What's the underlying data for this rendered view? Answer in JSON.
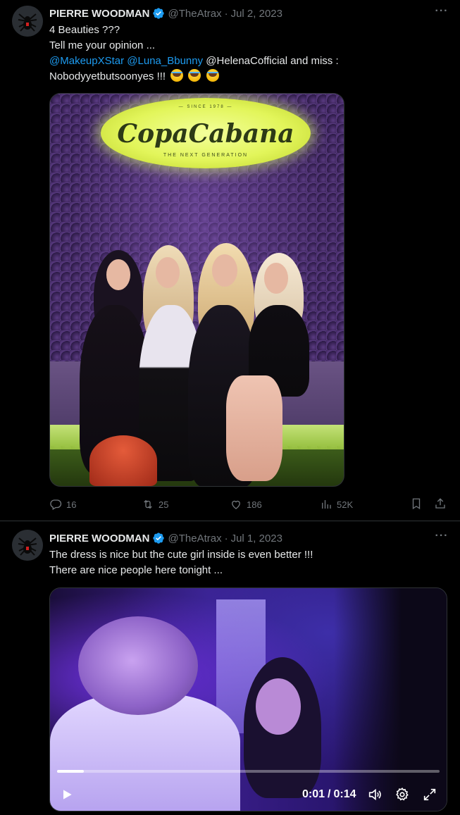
{
  "tweets": [
    {
      "author": {
        "name": "PIERRE WOODMAN",
        "handle": "@TheAtrax",
        "separator": "·",
        "date": "Jul 2, 2023",
        "avatar_icon": "spider-icon",
        "verified_icon": "verified-badge-icon"
      },
      "more_icon": "more-icon",
      "more_label": "···",
      "text": {
        "line1": "4 Beauties ???",
        "line2": "Tell me your opinion ...",
        "mention1": "@MakeupXStar",
        "mention2": "@Luna_Bbunny",
        "line3_rest": "@HelenaCofficial and miss :",
        "line4": "Nobodyyetbutsoonyes !!!",
        "emoji": "face-with-tears-of-joy"
      },
      "media": {
        "sign_top": "— SINCE 1978 —",
        "sign_text": "CopaCabana",
        "sign_sub": "THE NEXT GENERATION"
      },
      "actions": {
        "replies": "16",
        "reposts": "25",
        "likes": "186",
        "views": "52K"
      }
    },
    {
      "author": {
        "name": "PIERRE WOODMAN",
        "handle": "@TheAtrax",
        "separator": "·",
        "date": "Jul 1, 2023",
        "avatar_icon": "spider-icon",
        "verified_icon": "verified-badge-icon"
      },
      "more_icon": "more-icon",
      "more_label": "···",
      "text": {
        "line1": "The dress is nice but the cute girl inside is even better !!!",
        "line2": "There are nice people here tonight ..."
      },
      "video": {
        "current_time": "0:01",
        "time_separator": "/",
        "duration": "0:14",
        "progress_fraction": 0.07
      }
    }
  ],
  "colors": {
    "background": "#000000",
    "text": "#e7e9ea",
    "muted": "#71767b",
    "link": "#1d9bf0",
    "border": "#2f3336"
  }
}
